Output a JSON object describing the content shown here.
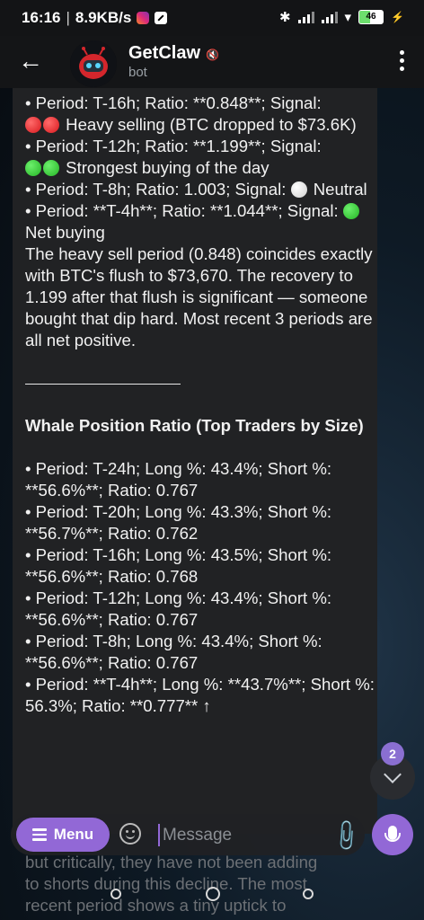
{
  "status": {
    "time": "16:16",
    "speed": "8.9KB/s",
    "battery": "46"
  },
  "header": {
    "title": "GetClaw",
    "subtitle": "bot"
  },
  "message": {
    "lines": [
      "• Period: T-16h; Ratio: **0.848**; Signal:",
      " Heavy selling (BTC dropped to $73.6K)",
      "• Period: T-12h; Ratio: **1.199**; Signal:",
      " Strongest buying of the day",
      "• Period: T-8h; Ratio: 1.003; Signal: ",
      "Neutral",
      "• Period: **T-4h**; Ratio: **1.044**;",
      "Signal: ",
      " Net buying",
      "The heavy sell period (0.848) coincides exactly with BTC's flush to $73,670. The recovery to 1.199 after that flush is significant — someone bought that dip hard. Most recent 3 periods are all net positive."
    ],
    "whale_title": "Whale Position Ratio (Top Traders by Size)",
    "whale_rows": [
      "• Period: T-24h; Long %: 43.4%; Short %: **56.6%**; Ratio: 0.767",
      "• Period: T-20h; Long %: 43.3%; Short %: **56.7%**; Ratio: 0.762",
      "• Period: T-16h; Long %: 43.5%; Short %: **56.6%**; Ratio: 0.768",
      "• Period: T-12h; Long %: 43.4%; Short %: **56.6%**; Ratio: 0.767",
      "• Period: T-8h; Long %: 43.4%; Short %: **56.6%**; Ratio: 0.767",
      "• Period: **T-4h**; Long %: **43.7%**; Short %: 56.3%; Ratio: **0.777** ↑"
    ],
    "faded_lines": [
      "but critically, they have not been adding",
      "to shorts during this decline. The most",
      "recent period shows a tiny uptick to"
    ]
  },
  "scroll": {
    "unread_count": "2"
  },
  "input": {
    "menu_label": "Menu",
    "placeholder": "Message"
  }
}
